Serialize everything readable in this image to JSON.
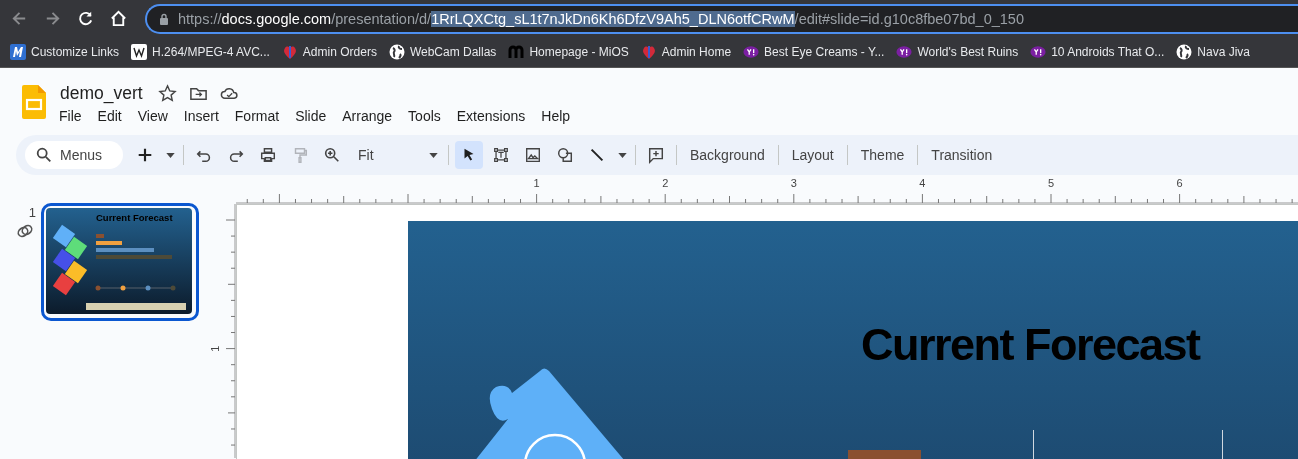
{
  "browser": {
    "url": {
      "scheme": "https://",
      "host": "docs.google.com",
      "path": "/presentation/d/",
      "selected_text": "1RrLQXCtg_sL1t7nJkDn6Kh6DfzV9Ah5_DLN6otfCRwM",
      "rest": "/edit#slide=id.g10c8fbe07bd_0_150"
    },
    "bookmarks": [
      {
        "label": "Customize Links",
        "kind": "m-logo"
      },
      {
        "label": "H.264/MPEG-4 AVC...",
        "kind": "w-logo"
      },
      {
        "label": "Admin Orders",
        "kind": "heart"
      },
      {
        "label": "WebCam Dallas",
        "kind": "globe"
      },
      {
        "label": "Homepage - MiOS",
        "kind": "m-letter"
      },
      {
        "label": "Admin Home",
        "kind": "heart"
      },
      {
        "label": "Best Eye Creams - Y...",
        "kind": "yahoo"
      },
      {
        "label": "World's Best Ruins",
        "kind": "yahoo"
      },
      {
        "label": "10 Androids That O...",
        "kind": "yahoo"
      },
      {
        "label": "Nava Jiva",
        "kind": "globe"
      }
    ]
  },
  "document": {
    "title": "demo_vert",
    "menus": [
      "File",
      "Edit",
      "View",
      "Insert",
      "Format",
      "Slide",
      "Arrange",
      "Tools",
      "Extensions",
      "Help"
    ]
  },
  "toolbar": {
    "search": {
      "placeholder": "Menus"
    },
    "groups": [
      [
        {
          "kind": "add",
          "selected": false,
          "disabled": false
        },
        {
          "kind": "caret",
          "selected": false,
          "disabled": false
        }
      ],
      [
        {
          "kind": "undo",
          "selected": false,
          "disabled": false
        },
        {
          "kind": "redo",
          "selected": false,
          "disabled": false
        },
        {
          "kind": "print",
          "selected": false,
          "disabled": false
        },
        {
          "kind": "paint",
          "selected": false,
          "disabled": true
        },
        {
          "kind": "zoom",
          "selected": false,
          "disabled": false
        },
        {
          "kind": "zoom-select",
          "label": "Fit",
          "selected": false,
          "disabled": false
        }
      ],
      [
        {
          "kind": "select",
          "selected": true,
          "disabled": false
        },
        {
          "kind": "textbox",
          "selected": false,
          "disabled": false
        },
        {
          "kind": "image",
          "selected": false,
          "disabled": false
        },
        {
          "kind": "shape",
          "selected": false,
          "disabled": false
        },
        {
          "kind": "line",
          "selected": false,
          "disabled": false
        },
        {
          "kind": "caret",
          "selected": false,
          "disabled": false
        }
      ],
      [
        {
          "kind": "comment",
          "selected": false,
          "disabled": false
        }
      ],
      [
        {
          "kind": "text",
          "label": "Background",
          "selected": false,
          "disabled": false
        }
      ],
      [
        {
          "kind": "text",
          "label": "Layout",
          "selected": false,
          "disabled": false
        }
      ],
      [
        {
          "kind": "text",
          "label": "Theme",
          "selected": false,
          "disabled": false
        }
      ],
      [
        {
          "kind": "text",
          "label": "Transition",
          "selected": false,
          "disabled": false
        }
      ]
    ]
  },
  "filmstrip": {
    "slides": [
      {
        "number": "1",
        "selected": true,
        "linked": true,
        "title": "Current Forecast"
      }
    ]
  },
  "rulers": {
    "horizontal": [
      "1",
      "2",
      "3",
      "4",
      "5",
      "6"
    ],
    "vertical": [
      "1"
    ]
  },
  "slide": {
    "title": "Current Forecast"
  }
}
